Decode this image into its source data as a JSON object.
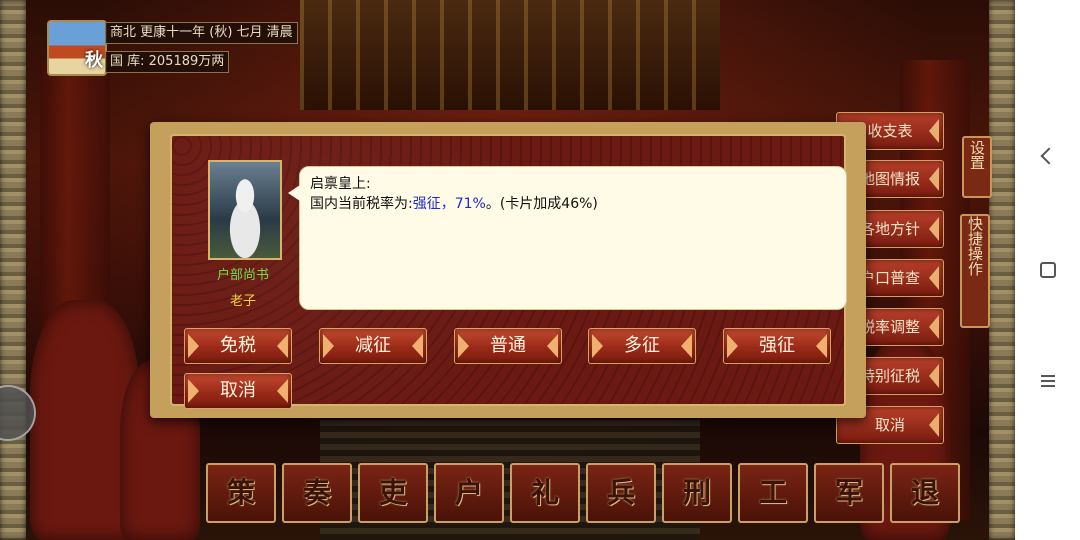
{
  "status": {
    "season_char": "秋",
    "date_line": "商北 更康十一年 (秋) 七月 清晨",
    "treasury_line": "国 库: 205189万两"
  },
  "side_menu": {
    "items": [
      "收支表",
      "地图情报",
      "各地方针",
      "户口普查",
      "税率调整",
      "特别征税",
      "取消"
    ],
    "settings_tab": "设置",
    "quick_tab": "快捷操作"
  },
  "ministries": [
    "策",
    "奏",
    "吏",
    "户",
    "礼",
    "兵",
    "刑",
    "工",
    "军",
    "退"
  ],
  "dialog": {
    "minister_title": "户部尚书",
    "minister_name": "老子",
    "greeting": "启禀皇上:",
    "line_prefix": "国内当前税率为:",
    "line_highlight": "强征，71%",
    "line_suffix": "。(卡片加成46%)",
    "options": [
      "免税",
      "减征",
      "普通",
      "多征",
      "强征"
    ],
    "cancel": "取消"
  },
  "colors": {
    "highlight_text": "#1a28d8",
    "minister_title": "#6fe04a",
    "minister_name": "#f0d040",
    "button_red": "#9a2a18",
    "dialog_gold": "#c4a05c"
  },
  "icons": {
    "nav_back": "back-icon",
    "nav_home": "home-icon",
    "nav_menu": "menu-icon",
    "float": "assistive-ball-icon"
  }
}
